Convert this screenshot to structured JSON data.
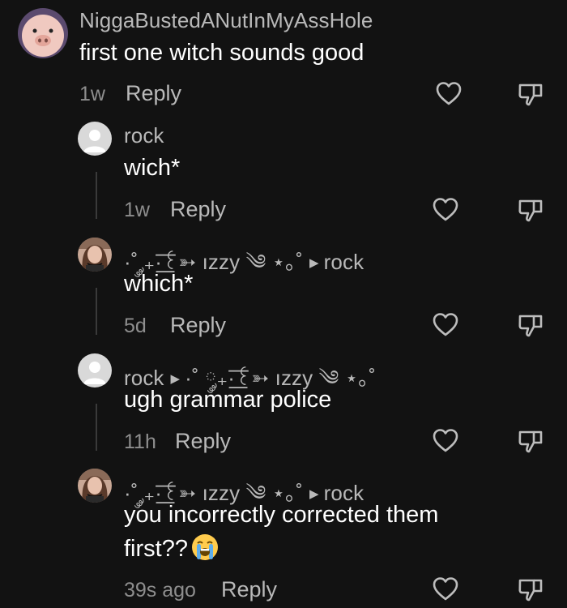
{
  "comments": [
    {
      "author": "NiggaBustedANutInMyAssHole",
      "text": "first one witch sounds good",
      "time": "1w",
      "reply_label": "Reply"
    },
    {
      "author": "rock",
      "text": "wich*",
      "time": "1w",
      "reply_label": "Reply"
    },
    {
      "author": "·˚ ༘₊·͟͟͞͞꒰➳ ızzy ༄ ⋆｡˚",
      "reply_to": "rock",
      "text": "which*",
      "time": "5d",
      "reply_label": "Reply"
    },
    {
      "author": "rock",
      "reply_to": "·˚ ༘₊·͟͟͞͞꒰➳ ızzy ༄ ⋆｡˚",
      "text": "ugh grammar police",
      "time": "11h",
      "reply_label": "Reply"
    },
    {
      "author": "·˚ ༘₊·͟͟͞͞꒰➳ ızzy ༄ ⋆｡˚",
      "reply_to": "rock",
      "text_line1": "you incorrectly corrected them",
      "text_line2": "first??",
      "time": "39s ago",
      "reply_label": "Reply"
    }
  ],
  "icons": {
    "like": "heart-outline-icon",
    "dislike": "thumbs-down-outline-icon",
    "emoji": "loudly-crying-face-emoji"
  },
  "colors": {
    "background": "#121212",
    "text": "#ffffff",
    "secondary": "#b9b9b9",
    "muted": "#8e8e8e"
  }
}
